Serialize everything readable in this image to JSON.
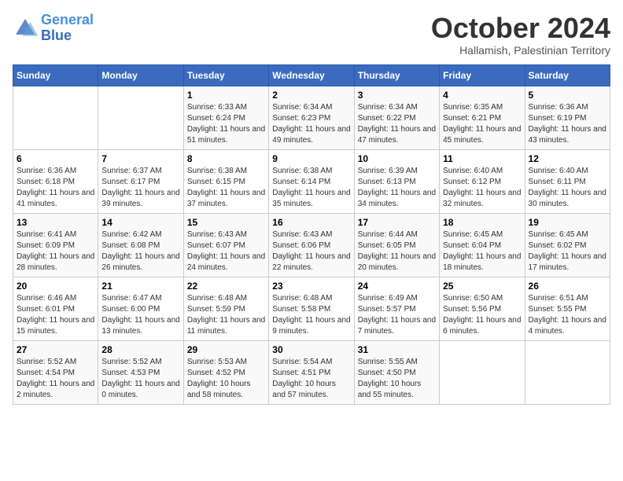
{
  "header": {
    "logo_line1": "General",
    "logo_line2": "Blue",
    "title": "October 2024",
    "subtitle": "Hallamish, Palestinian Territory"
  },
  "days_of_week": [
    "Sunday",
    "Monday",
    "Tuesday",
    "Wednesday",
    "Thursday",
    "Friday",
    "Saturday"
  ],
  "weeks": [
    [
      {
        "day": "",
        "info": ""
      },
      {
        "day": "",
        "info": ""
      },
      {
        "day": "1",
        "info": "Sunrise: 6:33 AM\nSunset: 6:24 PM\nDaylight: 11 hours and 51 minutes."
      },
      {
        "day": "2",
        "info": "Sunrise: 6:34 AM\nSunset: 6:23 PM\nDaylight: 11 hours and 49 minutes."
      },
      {
        "day": "3",
        "info": "Sunrise: 6:34 AM\nSunset: 6:22 PM\nDaylight: 11 hours and 47 minutes."
      },
      {
        "day": "4",
        "info": "Sunrise: 6:35 AM\nSunset: 6:21 PM\nDaylight: 11 hours and 45 minutes."
      },
      {
        "day": "5",
        "info": "Sunrise: 6:36 AM\nSunset: 6:19 PM\nDaylight: 11 hours and 43 minutes."
      }
    ],
    [
      {
        "day": "6",
        "info": "Sunrise: 6:36 AM\nSunset: 6:18 PM\nDaylight: 11 hours and 41 minutes."
      },
      {
        "day": "7",
        "info": "Sunrise: 6:37 AM\nSunset: 6:17 PM\nDaylight: 11 hours and 39 minutes."
      },
      {
        "day": "8",
        "info": "Sunrise: 6:38 AM\nSunset: 6:15 PM\nDaylight: 11 hours and 37 minutes."
      },
      {
        "day": "9",
        "info": "Sunrise: 6:38 AM\nSunset: 6:14 PM\nDaylight: 11 hours and 35 minutes."
      },
      {
        "day": "10",
        "info": "Sunrise: 6:39 AM\nSunset: 6:13 PM\nDaylight: 11 hours and 34 minutes."
      },
      {
        "day": "11",
        "info": "Sunrise: 6:40 AM\nSunset: 6:12 PM\nDaylight: 11 hours and 32 minutes."
      },
      {
        "day": "12",
        "info": "Sunrise: 6:40 AM\nSunset: 6:11 PM\nDaylight: 11 hours and 30 minutes."
      }
    ],
    [
      {
        "day": "13",
        "info": "Sunrise: 6:41 AM\nSunset: 6:09 PM\nDaylight: 11 hours and 28 minutes."
      },
      {
        "day": "14",
        "info": "Sunrise: 6:42 AM\nSunset: 6:08 PM\nDaylight: 11 hours and 26 minutes."
      },
      {
        "day": "15",
        "info": "Sunrise: 6:43 AM\nSunset: 6:07 PM\nDaylight: 11 hours and 24 minutes."
      },
      {
        "day": "16",
        "info": "Sunrise: 6:43 AM\nSunset: 6:06 PM\nDaylight: 11 hours and 22 minutes."
      },
      {
        "day": "17",
        "info": "Sunrise: 6:44 AM\nSunset: 6:05 PM\nDaylight: 11 hours and 20 minutes."
      },
      {
        "day": "18",
        "info": "Sunrise: 6:45 AM\nSunset: 6:04 PM\nDaylight: 11 hours and 18 minutes."
      },
      {
        "day": "19",
        "info": "Sunrise: 6:45 AM\nSunset: 6:02 PM\nDaylight: 11 hours and 17 minutes."
      }
    ],
    [
      {
        "day": "20",
        "info": "Sunrise: 6:46 AM\nSunset: 6:01 PM\nDaylight: 11 hours and 15 minutes."
      },
      {
        "day": "21",
        "info": "Sunrise: 6:47 AM\nSunset: 6:00 PM\nDaylight: 11 hours and 13 minutes."
      },
      {
        "day": "22",
        "info": "Sunrise: 6:48 AM\nSunset: 5:59 PM\nDaylight: 11 hours and 11 minutes."
      },
      {
        "day": "23",
        "info": "Sunrise: 6:48 AM\nSunset: 5:58 PM\nDaylight: 11 hours and 9 minutes."
      },
      {
        "day": "24",
        "info": "Sunrise: 6:49 AM\nSunset: 5:57 PM\nDaylight: 11 hours and 7 minutes."
      },
      {
        "day": "25",
        "info": "Sunrise: 6:50 AM\nSunset: 5:56 PM\nDaylight: 11 hours and 6 minutes."
      },
      {
        "day": "26",
        "info": "Sunrise: 6:51 AM\nSunset: 5:55 PM\nDaylight: 11 hours and 4 minutes."
      }
    ],
    [
      {
        "day": "27",
        "info": "Sunrise: 5:52 AM\nSunset: 4:54 PM\nDaylight: 11 hours and 2 minutes."
      },
      {
        "day": "28",
        "info": "Sunrise: 5:52 AM\nSunset: 4:53 PM\nDaylight: 11 hours and 0 minutes."
      },
      {
        "day": "29",
        "info": "Sunrise: 5:53 AM\nSunset: 4:52 PM\nDaylight: 10 hours and 58 minutes."
      },
      {
        "day": "30",
        "info": "Sunrise: 5:54 AM\nSunset: 4:51 PM\nDaylight: 10 hours and 57 minutes."
      },
      {
        "day": "31",
        "info": "Sunrise: 5:55 AM\nSunset: 4:50 PM\nDaylight: 10 hours and 55 minutes."
      },
      {
        "day": "",
        "info": ""
      },
      {
        "day": "",
        "info": ""
      }
    ]
  ]
}
